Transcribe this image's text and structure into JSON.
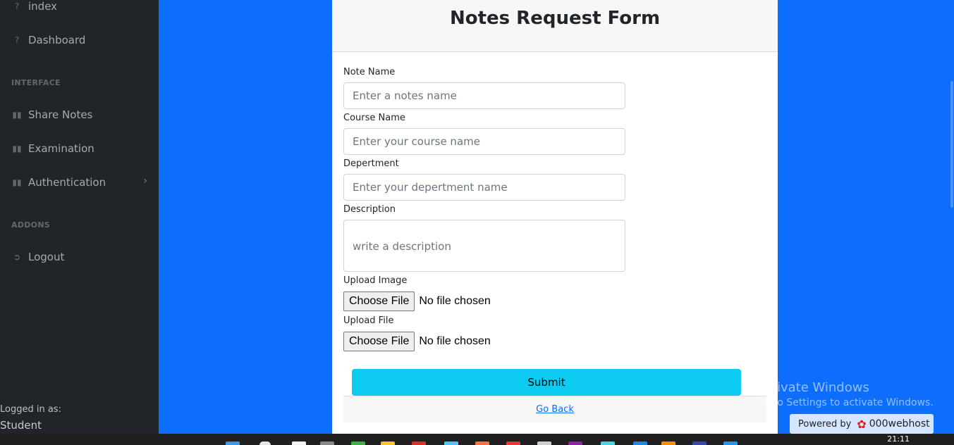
{
  "sidebar": {
    "items_top": [
      {
        "label": "index",
        "icon": "circle-question-icon"
      },
      {
        "label": "Dashboard",
        "icon": "circle-question-icon"
      }
    ],
    "heading_interface": "INTERFACE",
    "interface_items": [
      {
        "label": "Share Notes",
        "icon": "book-icon"
      },
      {
        "label": "Examination",
        "icon": "book-icon"
      },
      {
        "label": "Authentication",
        "icon": "book-icon"
      }
    ],
    "heading_addons": "ADDONS",
    "logout_label": "Logout",
    "footer_small": "Logged in as:",
    "footer_user": "Student"
  },
  "form": {
    "title": "Notes Request Form",
    "note_name_label": "Note Name",
    "note_name_placeholder": "Enter a notes name",
    "course_label": "Course Name",
    "course_placeholder": "Enter your course name",
    "dept_label": "Depertment",
    "dept_placeholder": "Enter your depertment name",
    "desc_label": "Description",
    "desc_placeholder": "write a description",
    "image_label": "Upload Image",
    "file_label": "Upload File",
    "choose_file": "Choose File",
    "no_file": "No file chosen",
    "submit_label": "Submit",
    "go_back": "Go Back"
  },
  "watermark": {
    "line1": "Activate Windows",
    "line2": "Go to Settings to activate Windows."
  },
  "powered": {
    "label": "Powered by",
    "brand": "000webhost"
  },
  "taskbar": {
    "clock": "21:11"
  },
  "colors": {
    "background": "#0d6efd",
    "sidebar": "#212529",
    "submit": "#0dcaf0"
  }
}
